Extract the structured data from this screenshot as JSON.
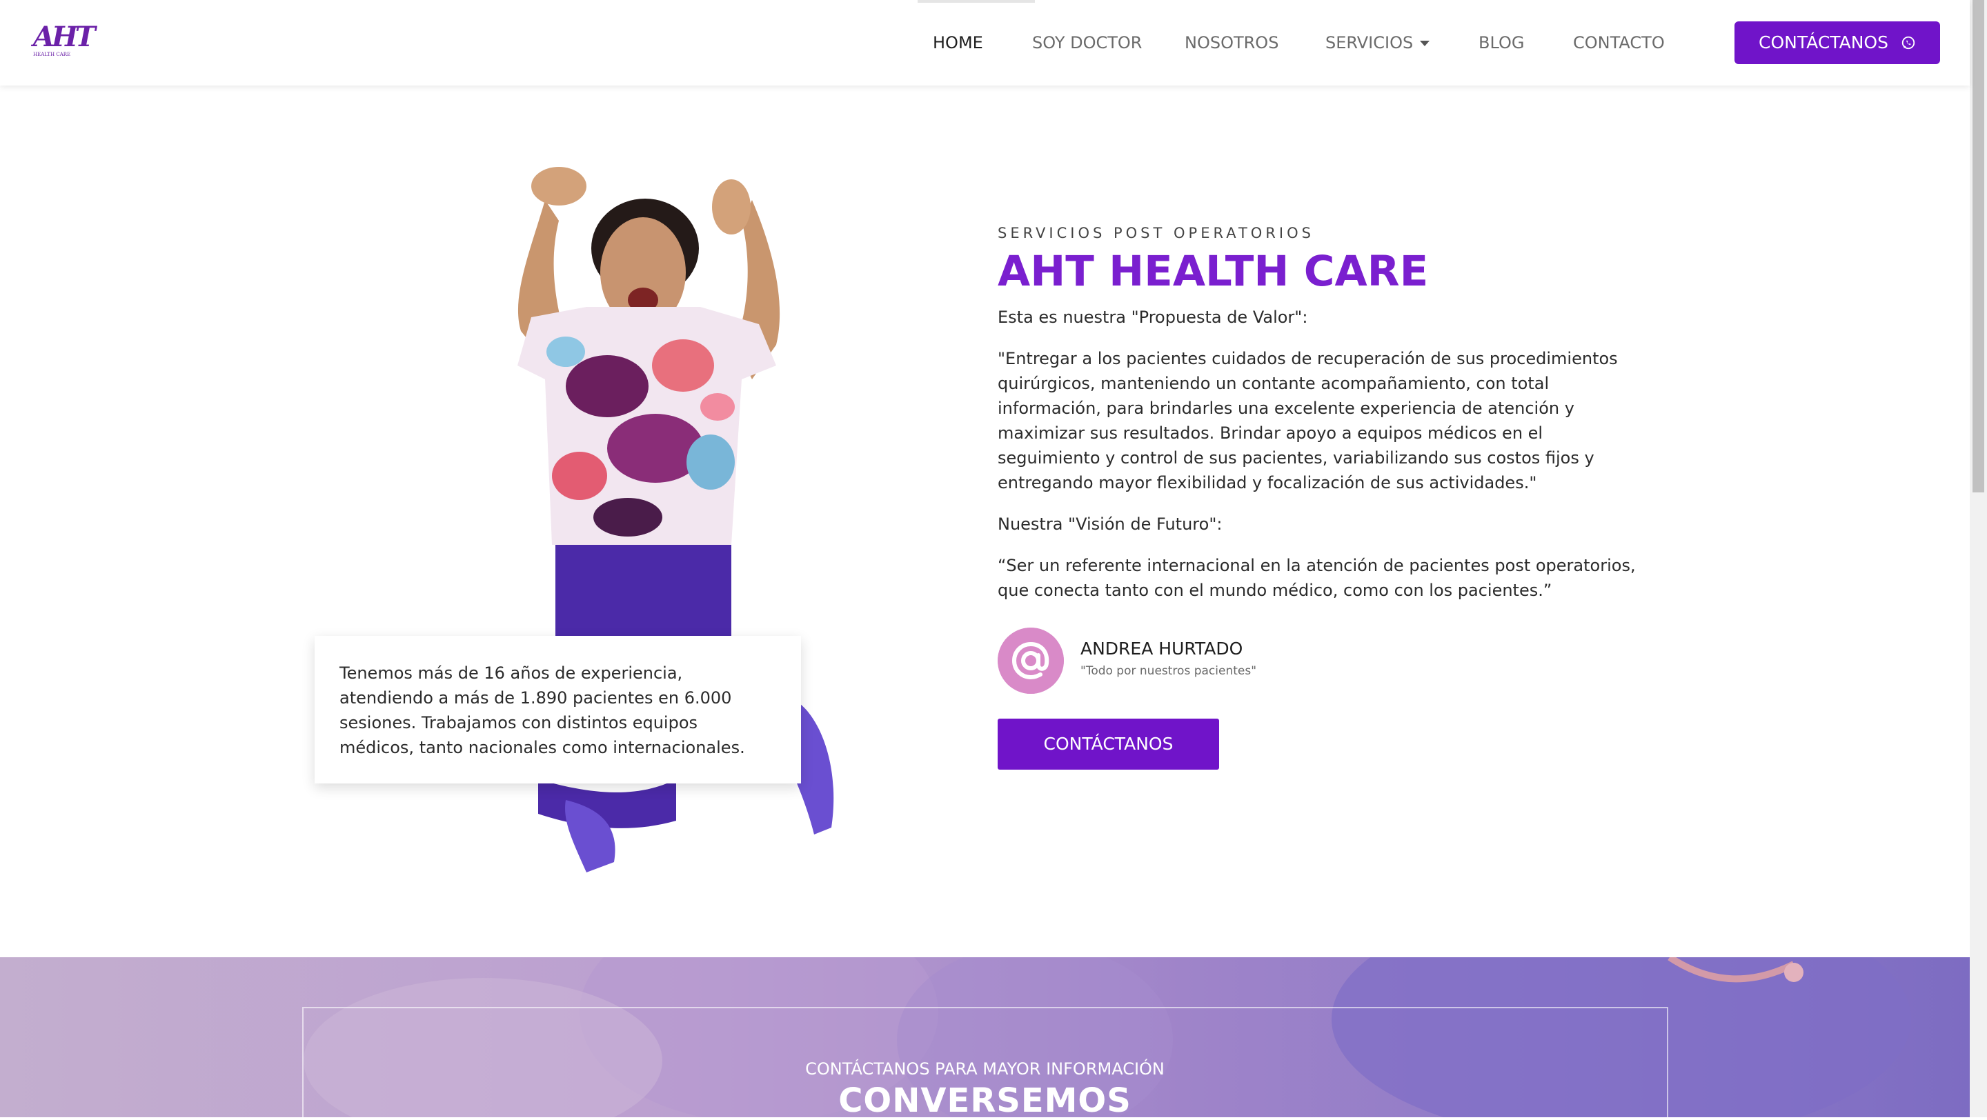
{
  "brand": {
    "logo_mark": "AHT",
    "logo_sub": "HEALTH CARE"
  },
  "nav": {
    "items": [
      {
        "label": "HOME"
      },
      {
        "label": "SOY DOCTOR"
      },
      {
        "label": "NOSOTROS"
      },
      {
        "label": "SERVICIOS"
      },
      {
        "label": "BLOG"
      },
      {
        "label": "CONTACTO"
      }
    ],
    "cta_label": "CONTÁCTANOS"
  },
  "hero": {
    "card_text": "Tenemos más de 16 años de experiencia, atendiendo a más de 1.890 pacientes en 6.000 sesiones. Trabajamos con distintos equipos médicos, tanto nacionales como internacionales.",
    "eyebrow": "SERVICIOS POST OPERATORIOS",
    "title": "AHT HEALTH CARE",
    "value_intro": "Esta es nuestra \"Propuesta de Valor\":",
    "value_text": "\"Entregar a los pacientes cuidados de recuperación de sus procedimientos quirúrgicos, manteniendo un contante acompañamiento, con total información, para brindarles una excelente experiencia de atención y maximizar sus resultados. Brindar apoyo a equipos médicos en el seguimiento y control de sus pacientes, variabilizando sus costos fijos y entregando mayor flexibilidad y focalización de sus actividades.\"",
    "vision_intro": "Nuestra \"Visión de Futuro\":",
    "vision_text": "“Ser un referente internacional en la atención de pacientes post operatorios, que conecta tanto con el mundo médico, como con los pacientes.”",
    "author_name": "ANDREA HURTADO",
    "author_quote": "\"Todo por nuestros pacientes\"",
    "cta_label": "CONTÁCTANOS"
  },
  "banner": {
    "eyebrow": "CONTÁCTANOS PARA MAYOR INFORMACIÓN",
    "title": "CONVERSEMOS"
  },
  "colors": {
    "accent": "#7014c9",
    "title": "#7a1fcf",
    "avatar": "#d98ac8"
  }
}
